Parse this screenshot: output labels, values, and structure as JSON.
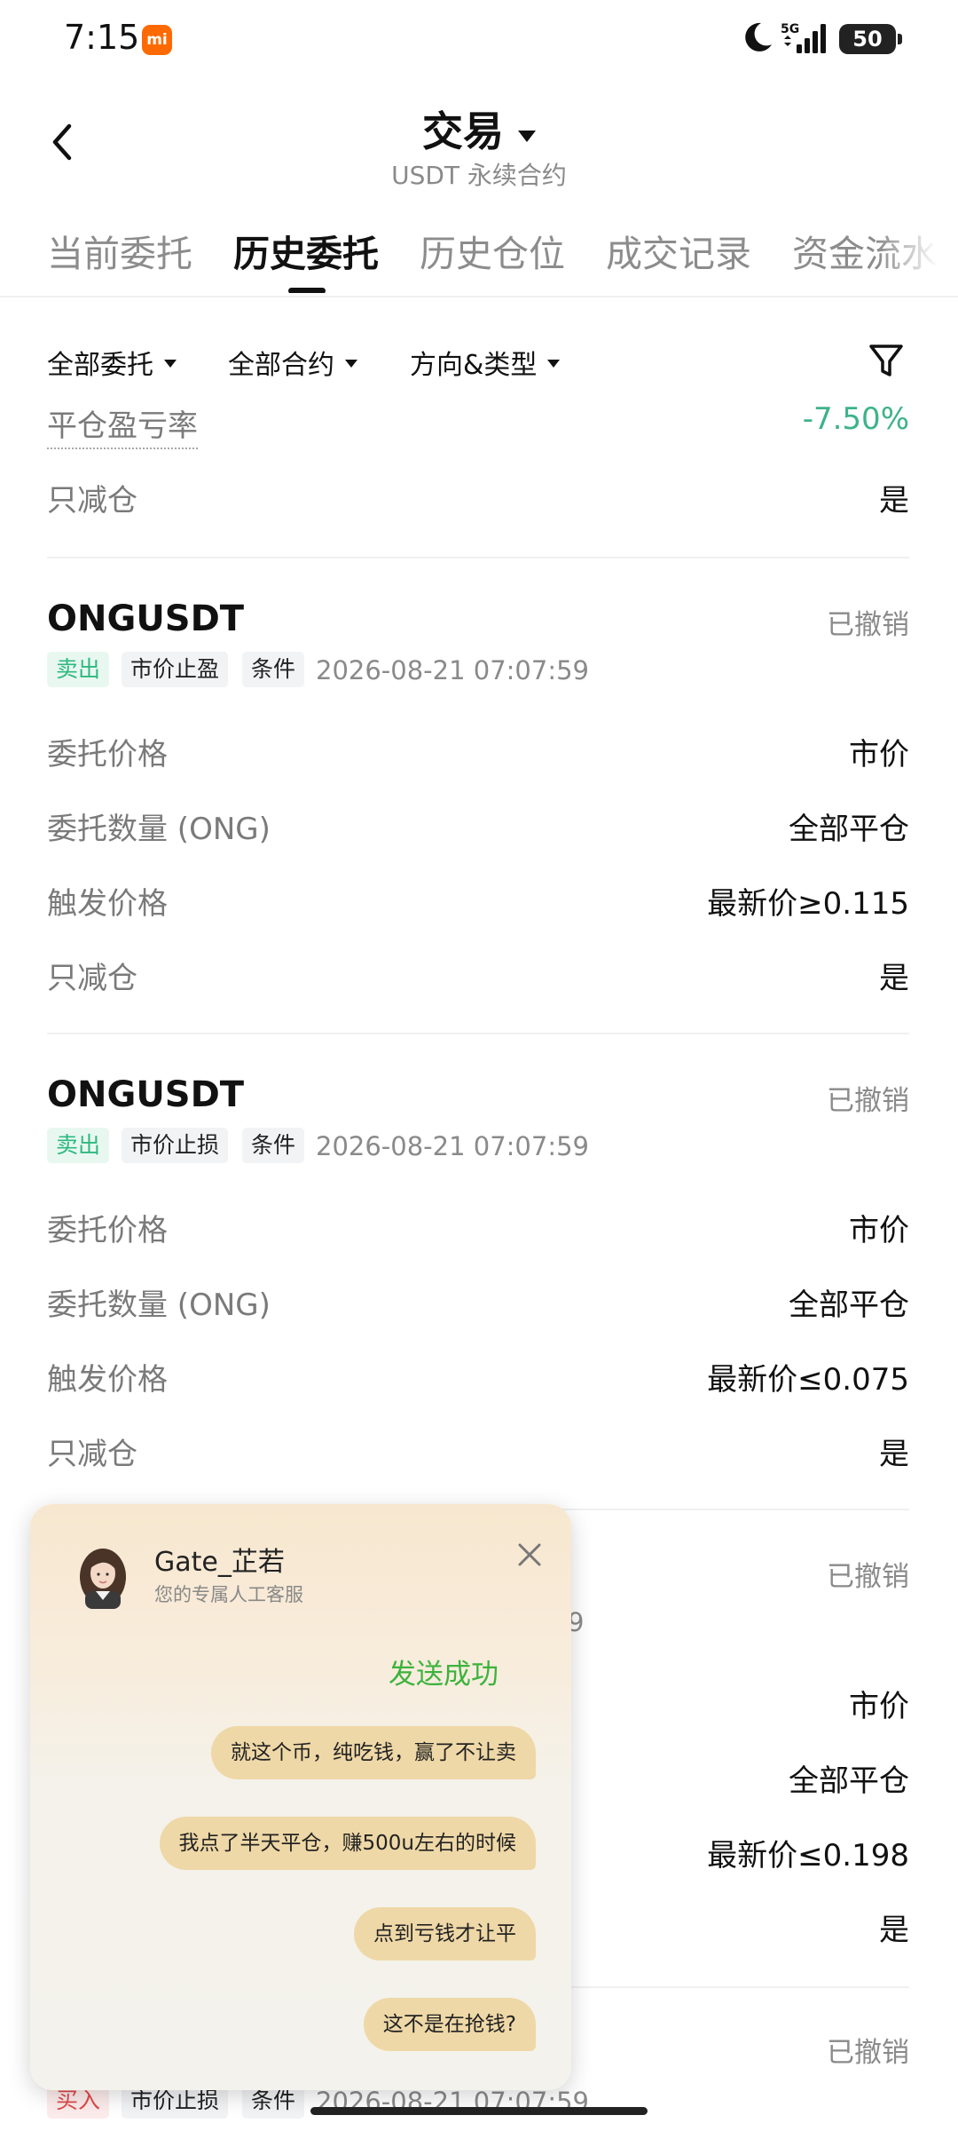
{
  "status_bar": {
    "time": "7:15",
    "carrier_icon": "mi-icon",
    "network": "5G",
    "battery": "50"
  },
  "header": {
    "title": "交易",
    "subtitle": "USDT 永续合约"
  },
  "tabs": [
    {
      "label": "当前委托",
      "active": false
    },
    {
      "label": "历史委托",
      "active": true
    },
    {
      "label": "历史仓位",
      "active": false
    },
    {
      "label": "成交记录",
      "active": false
    },
    {
      "label": "资金流水",
      "active": false
    }
  ],
  "filters": {
    "order_type": "全部委托",
    "contract": "全部合约",
    "direction_type": "方向&类型"
  },
  "partial_order": {
    "rows": [
      {
        "label": "平仓盈亏率",
        "value": "-7.50%"
      },
      {
        "label": "只减仓",
        "value": "是"
      }
    ]
  },
  "orders": [
    {
      "symbol": "ONGUSDT",
      "status": "已撤销",
      "side": "卖出",
      "type": "市价止盈",
      "kind": "条件",
      "time": "2026-08-21 07:07:59",
      "rows": [
        {
          "label": "委托价格",
          "value": "市价"
        },
        {
          "label": "委托数量 (ONG)",
          "value": "全部平仓"
        },
        {
          "label": "触发价格",
          "value": "最新价≥0.115"
        },
        {
          "label": "只减仓",
          "value": "是"
        }
      ]
    },
    {
      "symbol": "ONGUSDT",
      "status": "已撤销",
      "side": "卖出",
      "type": "市价止损",
      "kind": "条件",
      "time": "2026-08-21 07:07:59",
      "rows": [
        {
          "label": "委托价格",
          "value": "市价"
        },
        {
          "label": "委托数量 (ONG)",
          "value": "全部平仓"
        },
        {
          "label": "触发价格",
          "value": "最新价≤0.075"
        },
        {
          "label": "只减仓",
          "value": "是"
        }
      ]
    },
    {
      "status": "已撤销",
      "time_fragment": "9",
      "rows": [
        {
          "value": "市价"
        },
        {
          "value": "全部平仓"
        },
        {
          "value": "最新价≤0.198"
        },
        {
          "value": "是"
        }
      ]
    },
    {
      "status": "已撤销",
      "side": "买入",
      "type": "市价止损",
      "kind": "条件",
      "time": "2026-08-21 07:07:59"
    }
  ],
  "chat": {
    "agent_name": "Gate_芷若",
    "agent_role": "您的专属人工客服",
    "send_status": "发送成功",
    "messages": [
      "就这个币，纯吃钱，赢了不让卖",
      "我点了半天平仓，赚500u左右的时候",
      "点到亏钱才让平",
      "这不是在抢钱?"
    ]
  },
  "colors": {
    "profit_negative": "#3db389",
    "sell_tag": "#2fb87f",
    "buy_tag": "#e2494a",
    "send_success": "#3cb33c",
    "bubble": "#efd8a7"
  }
}
